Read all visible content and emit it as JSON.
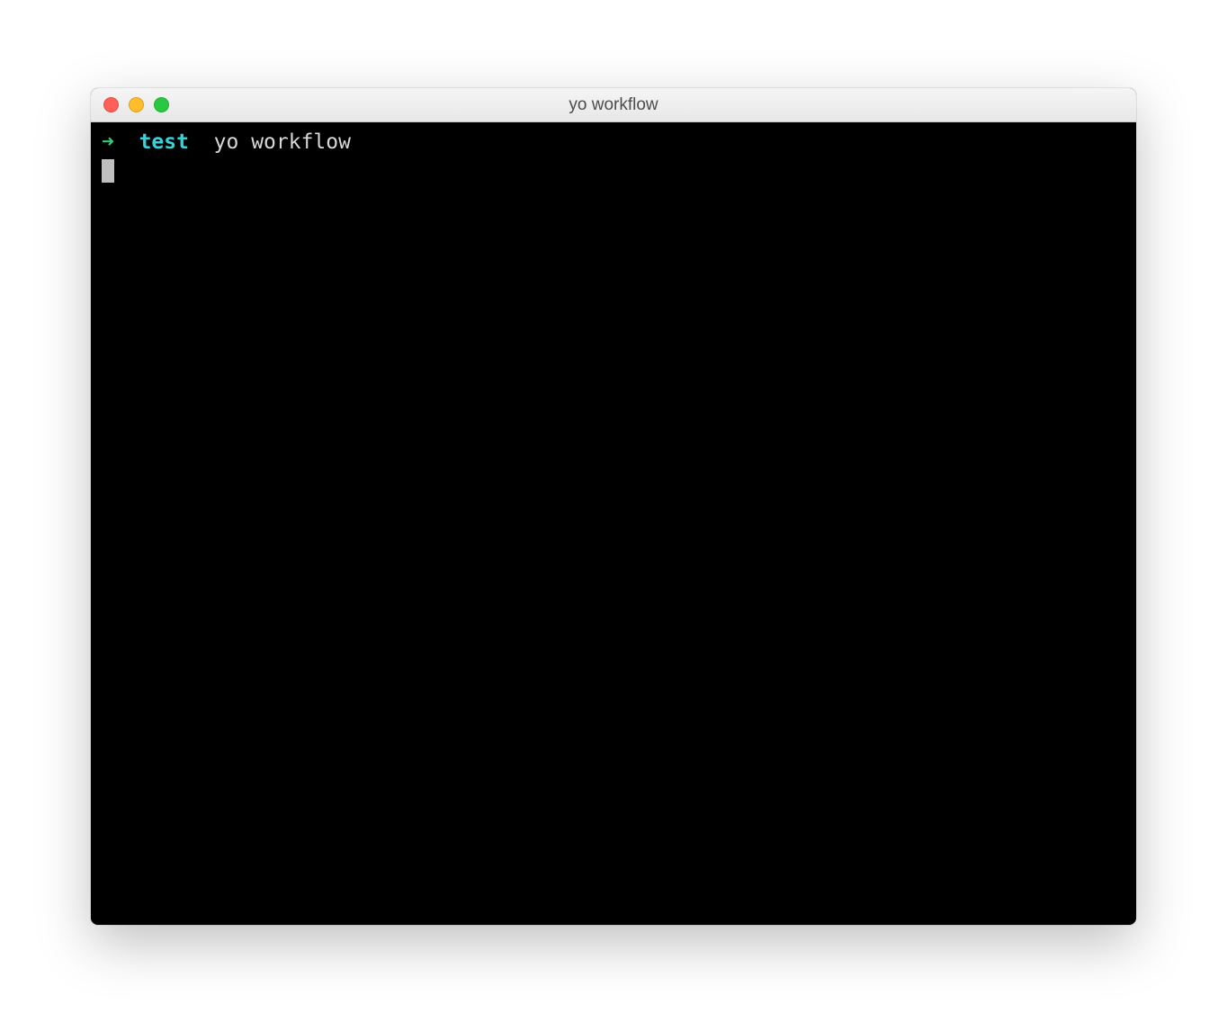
{
  "window": {
    "title": "yo workflow"
  },
  "terminal": {
    "prompt_arrow": "➜",
    "prompt_context": "test",
    "command": "yo workflow"
  }
}
